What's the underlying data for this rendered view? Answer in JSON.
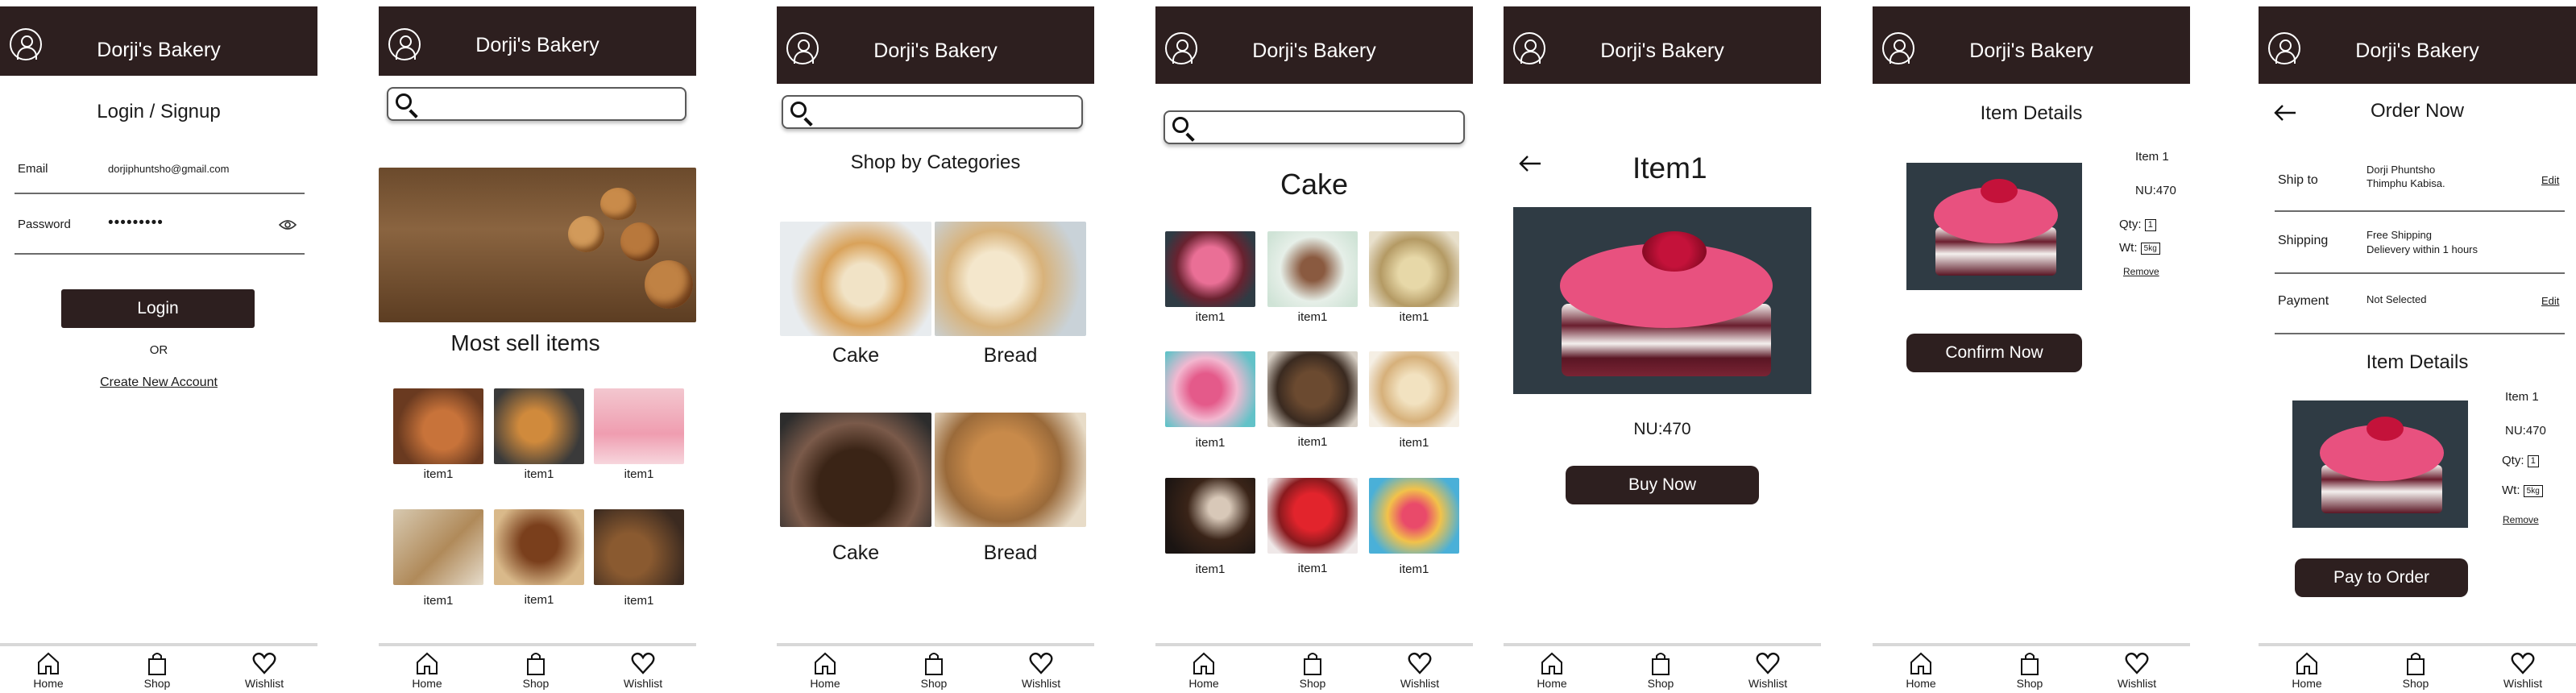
{
  "app_name": "Dorji's Bakery",
  "colors": {
    "brand": "#2d1f1f",
    "accent_pink": "#e8517f"
  },
  "tabbar": {
    "home": "Home",
    "shop": "Shop",
    "wishlist": "Wishlist"
  },
  "login": {
    "title": "Login / Signup",
    "email_label": "Email",
    "email_value": "dorjiphuntsho@gmail.com",
    "password_label": "Password",
    "password_value": "•••••••••",
    "login_button": "Login",
    "or": "OR",
    "create_account": "Create New Account"
  },
  "home": {
    "section_title": "Most sell items",
    "item_caption": "item1"
  },
  "categories": {
    "title": "Shop by Categories",
    "items": [
      "Cake",
      "Bread",
      "Cake",
      "Bread"
    ]
  },
  "cake_list": {
    "title": "Cake",
    "item_caption": "item1"
  },
  "product": {
    "title": "Item1",
    "price": "NU:470",
    "buy_button": "Buy Now"
  },
  "item_details": {
    "title": "Item Details",
    "name": "Item 1",
    "price": "NU:470",
    "qty_label": "Qty:",
    "qty_value": "1",
    "wt_label": "Wt:",
    "wt_value": "5kg",
    "remove": "Remove",
    "confirm_button": "Confirm Now"
  },
  "order": {
    "title": "Order Now",
    "ship_label": "Ship to",
    "ship_line1": "Dorji Phuntsho",
    "ship_line2": "Thimphu Kabisa.",
    "edit": "Edit",
    "shipping_label": "Shipping",
    "shipping_line1": "Free Shipping",
    "shipping_line2": "Delievery within 1 hours",
    "payment_label": "Payment",
    "payment_value": "Not Selected",
    "details_title": "Item Details",
    "pay_button": "Pay to Order"
  }
}
